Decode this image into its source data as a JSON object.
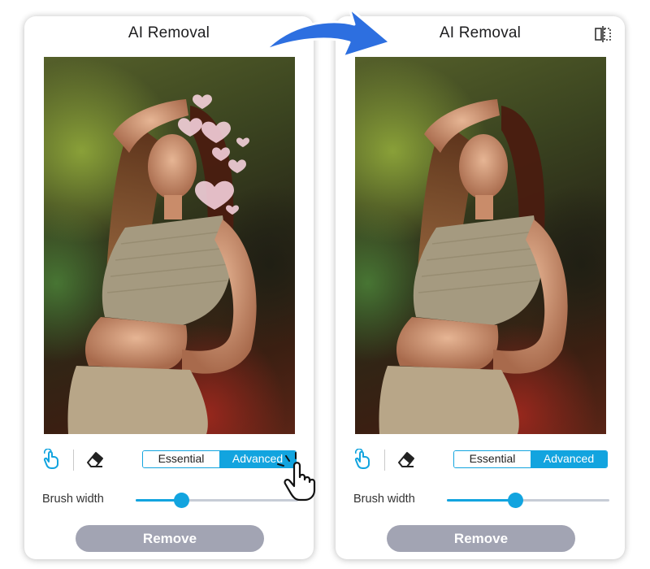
{
  "panels": [
    {
      "title": "AI Removal",
      "mode_tabs": [
        "Essential",
        "Advanced"
      ],
      "active_mode": "Advanced",
      "brush_width_label": "Brush width",
      "brush_width_level": 0.28,
      "remove_label": "Remove",
      "shows_hearts": true
    },
    {
      "title": "AI Removal",
      "mode_tabs": [
        "Essential",
        "Advanced"
      ],
      "active_mode": "Advanced",
      "brush_width_label": "Brush width",
      "brush_width_level": 0.42,
      "remove_label": "Remove",
      "shows_hearts": false
    }
  ],
  "icons": {
    "brush_tool": "brush-hand-icon",
    "eraser_tool": "eraser-icon",
    "compare": "compare-icon",
    "transition_arrow": "arrow-icon",
    "cursor": "hand-pointer-icon"
  },
  "colors": {
    "accent": "#12a4df",
    "remove_button": "#a2a4b3",
    "arrow": "#2d6fe0"
  }
}
